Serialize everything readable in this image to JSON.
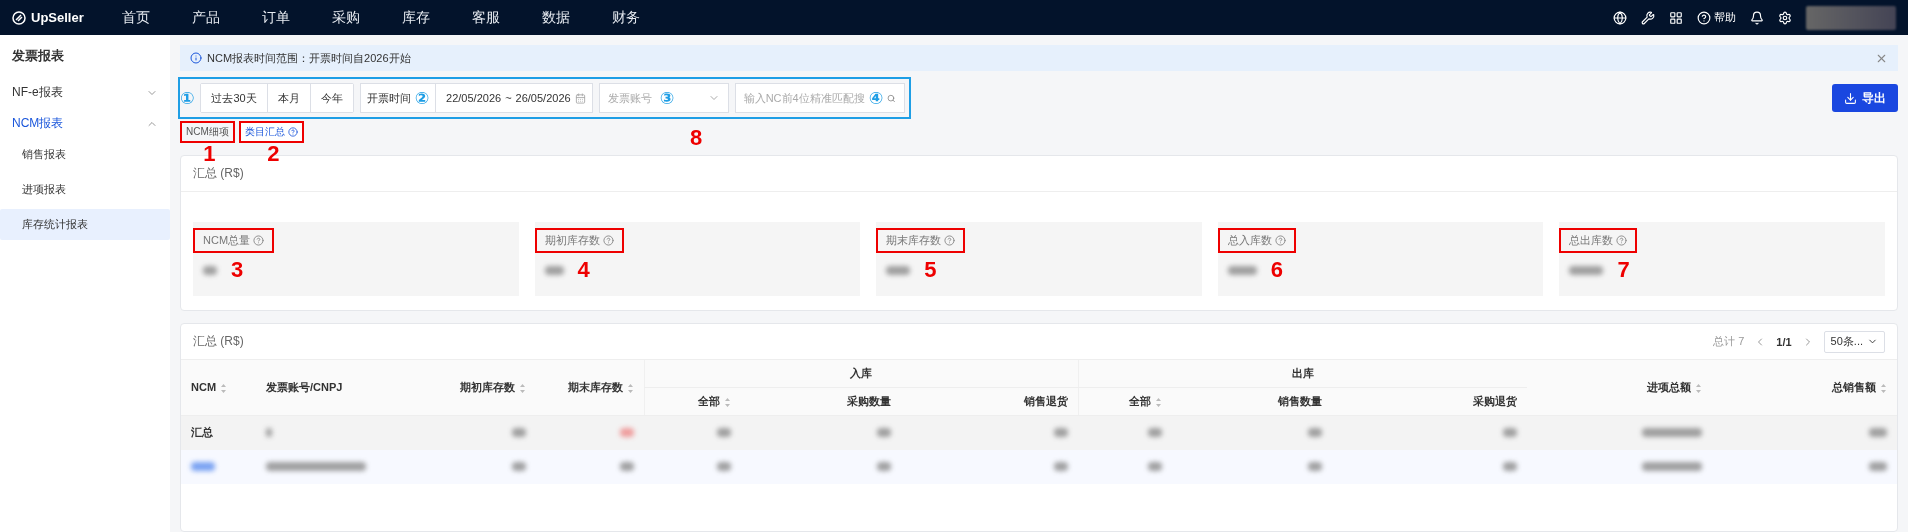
{
  "topbar": {
    "logo": "UpSeller",
    "nav": [
      {
        "label": "首页",
        "selected": false
      },
      {
        "label": "产品",
        "selected": false
      },
      {
        "label": "订单",
        "selected": false
      },
      {
        "label": "采购",
        "selected": false
      },
      {
        "label": "库存",
        "selected": false
      },
      {
        "label": "客服",
        "selected": false
      },
      {
        "label": "数据",
        "selected": false
      },
      {
        "label": "财务",
        "selected": false
      }
    ],
    "help": "帮助"
  },
  "sidebar": {
    "title": "发票报表",
    "items": [
      {
        "label": "NF-e报表",
        "selected": false,
        "expanded": false
      },
      {
        "label": "NCM报表",
        "selected": true,
        "expanded": true,
        "children": [
          {
            "label": "销售报表",
            "selected": false
          },
          {
            "label": "进项报表",
            "selected": false
          },
          {
            "label": "库存统计报表",
            "selected": true
          }
        ]
      }
    ]
  },
  "banner": {
    "text": "NCM报表时间范围：开票时间自2026开始"
  },
  "filters": {
    "outlined": true,
    "marker": "①",
    "ranges": [
      {
        "label": "过去30天",
        "selected": false
      },
      {
        "label": "本月",
        "selected": false
      },
      {
        "label": "今年",
        "selected": false
      }
    ],
    "date_label": "开票时间",
    "date_marker": "②",
    "date_from": "22/05/2026",
    "date_sep": "~",
    "date_to": "26/05/2026",
    "account_placeholder": "发票账号",
    "account_marker": "③",
    "search_placeholder": "输入NC前4位精准匹配搜",
    "search_marker": "④"
  },
  "export": "导出",
  "tabs": [
    {
      "label": "NCM细项",
      "selected": false,
      "annotation": "1"
    },
    {
      "label": "类目汇总",
      "selected": true,
      "help": true,
      "annotation": "2"
    }
  ],
  "tabs_annotation": "8",
  "summary": {
    "title": "汇总 (R$)",
    "metrics": [
      {
        "label": "NCM总量",
        "annotation": "3"
      },
      {
        "label": "期初库存数",
        "annotation": "4"
      },
      {
        "label": "期末库存数",
        "annotation": "5"
      },
      {
        "label": "总入库数",
        "annotation": "6"
      },
      {
        "label": "总出库数",
        "annotation": "7"
      }
    ]
  },
  "table": {
    "title": "汇总 (R$)",
    "total": "总计 7",
    "page": "1/1",
    "page_size": "50条...",
    "columns": [
      {
        "label": "NCM",
        "sortable": true
      },
      {
        "label": "发票账号/CNPJ",
        "sortable": false
      },
      {
        "label": "期初库存数",
        "sortable": true
      },
      {
        "label": "期末库存数",
        "sortable": true
      },
      {
        "label": "入库",
        "children": [
          {
            "label": "全部",
            "sortable": true
          },
          {
            "label": "采购数量",
            "sortable": false
          },
          {
            "label": "销售退货",
            "sortable": false
          }
        ]
      },
      {
        "label": "出库",
        "children": [
          {
            "label": "全部",
            "sortable": true
          },
          {
            "label": "销售数量",
            "sortable": false
          },
          {
            "label": "采购退货",
            "sortable": false
          }
        ]
      },
      {
        "label": "进项总额",
        "sortable": true
      },
      {
        "label": "总销售额",
        "sortable": true
      }
    ],
    "rows": [
      {
        "kind": "total",
        "label": "汇总"
      },
      {
        "kind": "item"
      }
    ]
  }
}
